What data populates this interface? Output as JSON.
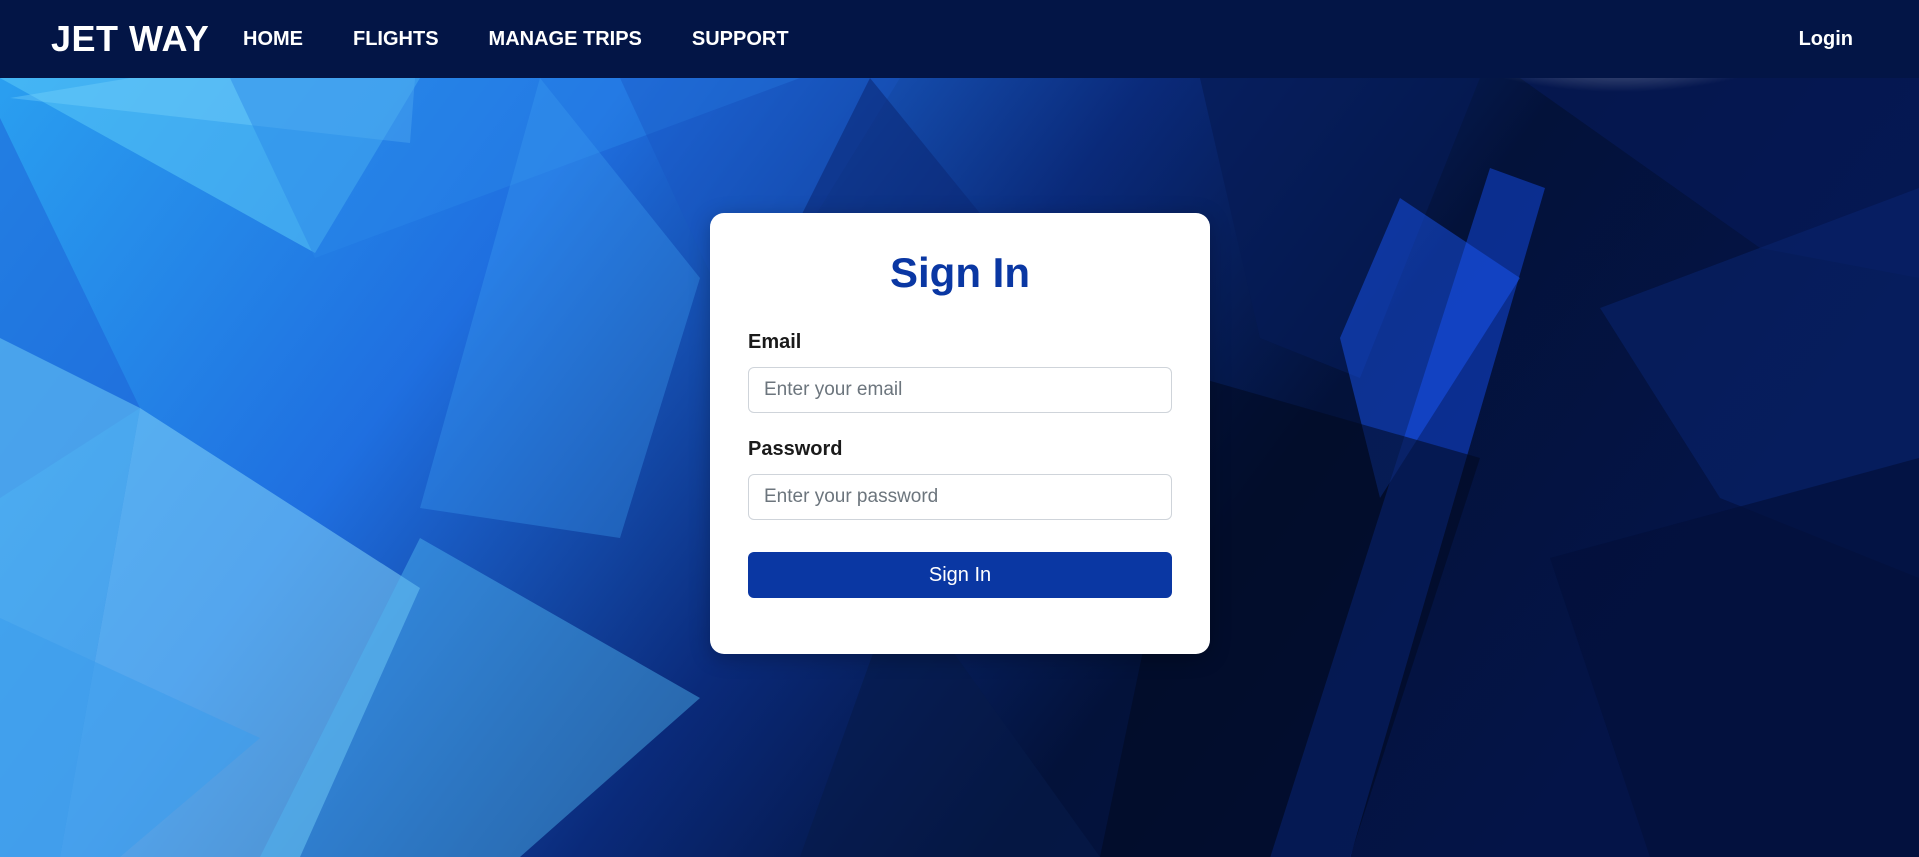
{
  "nav": {
    "brand": "JET WAY",
    "links": [
      {
        "label": "HOME"
      },
      {
        "label": "FLIGHTS"
      },
      {
        "label": "MANAGE TRIPS"
      },
      {
        "label": "SUPPORT"
      }
    ],
    "login_label": "Login"
  },
  "signin": {
    "title": "Sign In",
    "email_label": "Email",
    "email_placeholder": "Enter your email",
    "email_value": "",
    "password_label": "Password",
    "password_placeholder": "Enter your password",
    "password_value": "",
    "submit_label": "Sign In"
  },
  "colors": {
    "navbar": "#031546",
    "accent": "#0a37a3",
    "background_light": "#2ea3f2",
    "background_dark": "#020a22"
  }
}
